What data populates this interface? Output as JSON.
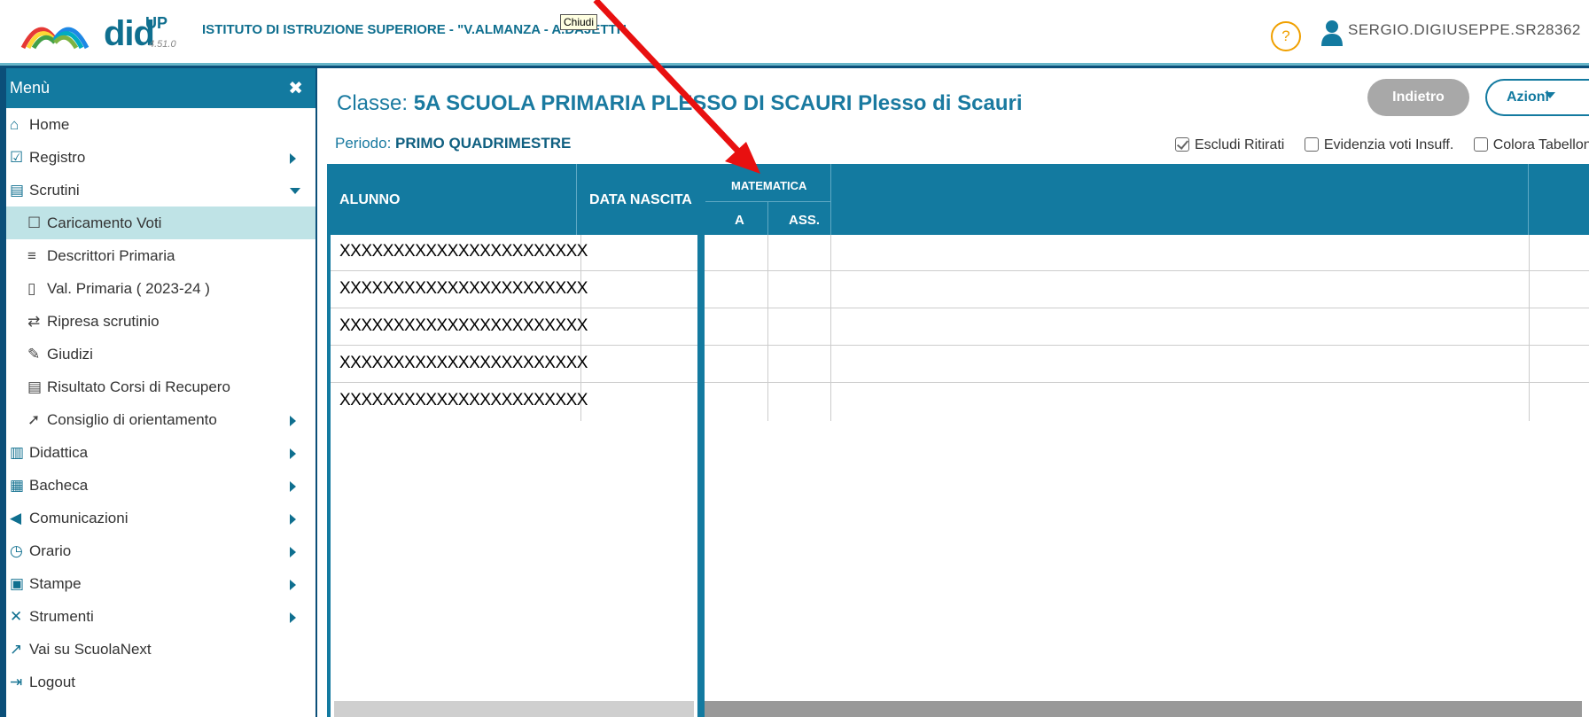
{
  "header": {
    "brand": "did",
    "brand_up": "UP",
    "version": "4.51.0",
    "school": "ISTITUTO DI ISTRUZIONE SUPERIORE - \"V.ALMANZA - A.DAJETTI\"",
    "tooltip": "Chiudi",
    "help": "?",
    "username": "SERGIO.DIGIUSEPPE.SR28362"
  },
  "sidebar": {
    "title": "Menù",
    "close": "✖",
    "items": [
      {
        "label": "Home",
        "icon": "⌂"
      },
      {
        "label": "Registro",
        "icon": "☑"
      },
      {
        "label": "Scrutini",
        "icon": "▤"
      },
      {
        "label": "Caricamento Voti",
        "icon": "☐"
      },
      {
        "label": "Descrittori Primaria",
        "icon": "≡"
      },
      {
        "label": "Val. Primaria ( 2023-24 )",
        "icon": "▯"
      },
      {
        "label": "Ripresa scrutinio",
        "icon": "⇄"
      },
      {
        "label": "Giudizi",
        "icon": "✎"
      },
      {
        "label": "Risultato Corsi di Recupero",
        "icon": "▤"
      },
      {
        "label": "Consiglio di orientamento",
        "icon": "➚"
      },
      {
        "label": "Didattica",
        "icon": "▥"
      },
      {
        "label": "Bacheca",
        "icon": "▦"
      },
      {
        "label": "Comunicazioni",
        "icon": "◀"
      },
      {
        "label": "Orario",
        "icon": "◷"
      },
      {
        "label": "Stampe",
        "icon": "▣"
      },
      {
        "label": "Strumenti",
        "icon": "✕"
      },
      {
        "label": "Vai su ScuolaNext",
        "icon": "↗"
      },
      {
        "label": "Logout",
        "icon": "⇥"
      }
    ]
  },
  "main": {
    "classe_label": "Classe: ",
    "classe_value": "5A SCUOLA PRIMARIA PLESSO DI SCAURI Plesso di Scauri",
    "periodo_label": "Periodo: ",
    "periodo_value": "PRIMO QUADRIMESTRE",
    "btn_indietro": "Indietro",
    "btn_azioni": "Azioni",
    "checks": [
      {
        "label": "Escludi Ritirati",
        "checked": true
      },
      {
        "label": "Evidenzia voti Insuff.",
        "checked": false
      },
      {
        "label": "Colora Tabellone",
        "checked": false
      }
    ],
    "table": {
      "col_alunno": "ALUNNO",
      "col_nascita": "DATA NASCITA",
      "subject": "MATEMATICA",
      "sub_a": "A",
      "sub_ass": "ASS.",
      "rows": [
        "XXXXXXXXXXXXXXXXXXXXXXX",
        "XXXXXXXXXXXXXXXXXXXXXXX",
        "XXXXXXXXXXXXXXXXXXXXXXX",
        "XXXXXXXXXXXXXXXXXXXXXXX",
        "XXXXXXXXXXXXXXXXXXXXXXX"
      ]
    }
  },
  "colors": {
    "primary": "#137aa0",
    "frame": "#0b4f79",
    "active_row": "#bfe3e6",
    "annotation": "#e81010"
  }
}
